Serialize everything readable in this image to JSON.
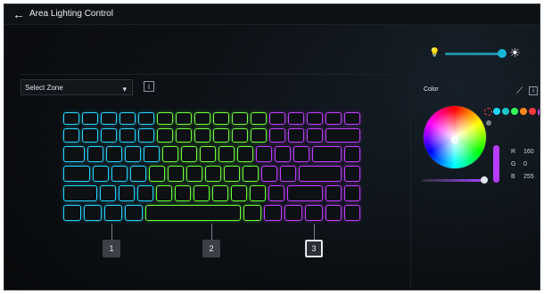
{
  "window": {
    "title": "Area Lighting Control"
  },
  "controls": {
    "zone_select_label": "Select Zone",
    "zones": [
      {
        "label": "1",
        "active": false
      },
      {
        "label": "2",
        "active": false
      },
      {
        "label": "3",
        "active": true
      }
    ]
  },
  "color_panel": {
    "label": "Color",
    "rgb": {
      "r": "160",
      "g": "0",
      "b": "255"
    }
  },
  "colors": {
    "zone1": "#26d6ff",
    "zone2": "#6cff3a",
    "zone3": "#c43cff",
    "accent": "#18b6d8",
    "selected_color": "#a000ff"
  }
}
